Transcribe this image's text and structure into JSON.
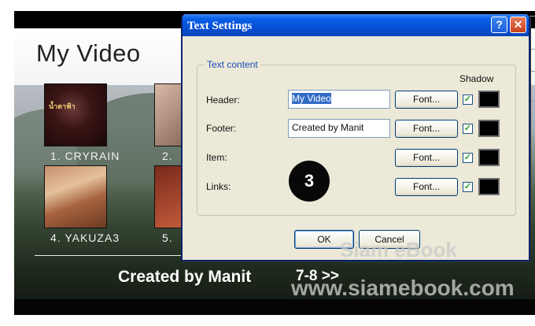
{
  "preview": {
    "title": "My Video",
    "items": [
      {
        "label": "1. CRYRAIN"
      },
      {
        "label": "2."
      },
      {
        "label": "4. YAKUZA3"
      },
      {
        "label": "5."
      }
    ],
    "footer": "Created by Manit",
    "links": "7-8 >>"
  },
  "dialog": {
    "title": "Text Settings",
    "help_label": "?",
    "close_label": "✕",
    "group_label": "Text content",
    "shadow_label": "Shadow",
    "rows": [
      {
        "label": "Header:",
        "value": "My Video",
        "font_button": "Font...",
        "shadow_checked": true,
        "shadow_color": "#000000"
      },
      {
        "label": "Footer:",
        "value": "Created by Manit",
        "font_button": "Font...",
        "shadow_checked": true,
        "shadow_color": "#000000"
      },
      {
        "label": "Item:",
        "font_button": "Font...",
        "shadow_checked": true,
        "shadow_color": "#000000"
      },
      {
        "label": "Links:",
        "font_button": "Font...",
        "shadow_checked": true,
        "shadow_color": "#000000"
      }
    ],
    "ok_label": "OK",
    "cancel_label": "Cancel"
  },
  "step_badge": "3",
  "watermarks": [
    "Siam eBook",
    "www.siamebook.com"
  ],
  "colors": {
    "titlebar": "#0a5fe8",
    "dialog_bg": "#ece9d8",
    "group_label": "#1b4ab9"
  }
}
